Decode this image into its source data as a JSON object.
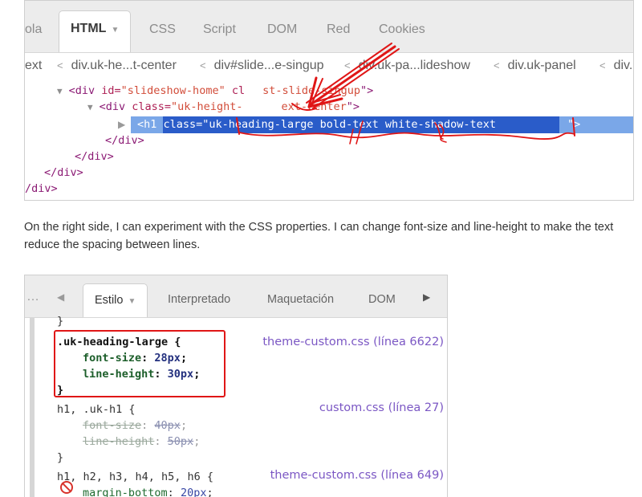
{
  "html_panel": {
    "tabs": [
      {
        "label": "ola"
      },
      {
        "label": "HTML",
        "active": true
      },
      {
        "label": "CSS"
      },
      {
        "label": "Script"
      },
      {
        "label": "DOM"
      },
      {
        "label": "Red"
      },
      {
        "label": "Cookies"
      }
    ],
    "tab_caret": "▼",
    "breadcrumbs": [
      "ext",
      "div.uk-he...t-center",
      "div#slide...e-singup",
      "div.uk-pa...lideshow",
      "div.uk-panel",
      "div."
    ],
    "tree": {
      "line1": {
        "open": "<div ",
        "attr1": "id=",
        "val1": "\"slideshow-home\"",
        "attr2": " cl",
        "val2": "st-slide-singup",
        "close": "\">"
      },
      "line2": {
        "open": "<div ",
        "attr": "class=",
        "val_a": "\"uk-height-",
        "val_b": "ext-center",
        "close": "\">"
      },
      "line3": {
        "open": "<h1 ",
        "attr": "class=\"",
        "val": "uk-heading-large bold-text white-shadow-text",
        "close": "\">"
      },
      "line4": "</div>",
      "line5": "</div>",
      "line6": "</div>",
      "line7": "/div>"
    },
    "annotation_color": "#e01616",
    "selection_color": "#2a5cc9"
  },
  "paragraph": {
    "line1": "On the right side, I can experiment with the CSS properties. I can change font-size and line-height to make the text",
    "line2": "reduce the spacing between lines."
  },
  "css_panel": {
    "tabs": [
      {
        "label": "Estilo",
        "active": true
      },
      {
        "label": "Interpretado"
      },
      {
        "label": "Maquetación"
      },
      {
        "label": "DOM"
      }
    ],
    "tab_caret": "▼",
    "rules": {
      "top_brace": "}",
      "r1": {
        "selector": ".uk-heading-large {",
        "p1": "font-size",
        "v1": "28px",
        "p2": "line-height",
        "v2": "30px",
        "close": "}",
        "source": "theme-custom.css (línea 6622)"
      },
      "r2": {
        "selector": "h1, .uk-h1 {",
        "p1": "font-size",
        "v1": "40px",
        "p2": "line-height",
        "v2": "50px",
        "close": "}",
        "source": "custom.css (línea 27)"
      },
      "r3": {
        "selector": "h1, h2, h3, h4, h5, h6 {",
        "p1": "margin-bottom",
        "v1": "20px",
        "source": "theme-custom.css (línea 649)"
      }
    },
    "highlight_color": "#e01616",
    "source_color": "#7b57c4"
  }
}
